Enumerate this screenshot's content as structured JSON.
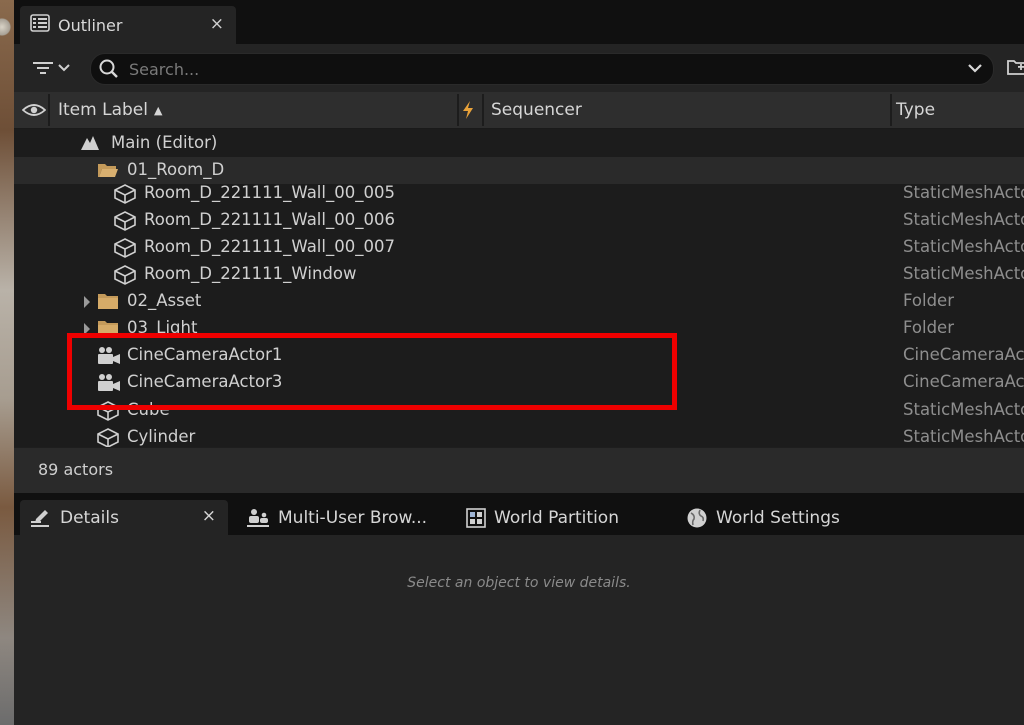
{
  "outliner": {
    "tab_title": "Outliner",
    "close_glyph": "×",
    "search_placeholder": "Search...",
    "columns": {
      "item_label": "Item Label",
      "sort_glyph": "▲",
      "sequencer": "Sequencer",
      "type": "Type"
    },
    "rows": [
      {
        "label": "Main (Editor)",
        "type": "",
        "icon": "level-icon"
      },
      {
        "label": "01_Room_D",
        "type": "",
        "icon": "folder-open-icon"
      },
      {
        "label": "Room_D_221111_Wall_00_005",
        "type": "StaticMeshActo",
        "icon": "static-mesh-icon"
      },
      {
        "label": "Room_D_221111_Wall_00_006",
        "type": "StaticMeshActo",
        "icon": "static-mesh-icon"
      },
      {
        "label": "Room_D_221111_Wall_00_007",
        "type": "StaticMeshActo",
        "icon": "static-mesh-icon"
      },
      {
        "label": "Room_D_221111_Window",
        "type": "StaticMeshActo",
        "icon": "static-mesh-icon"
      },
      {
        "label": "02_Asset",
        "type": "Folder",
        "icon": "folder-icon"
      },
      {
        "label": "03_Light",
        "type": "Folder",
        "icon": "folder-icon"
      },
      {
        "label": "CineCameraActor1",
        "type": "CineCameraAct",
        "icon": "camera-icon"
      },
      {
        "label": "CineCameraActor3",
        "type": "CineCameraAct",
        "icon": "camera-icon"
      },
      {
        "label": "Cube",
        "type": "StaticMeshActo",
        "icon": "static-mesh-icon"
      },
      {
        "label": "Cylinder",
        "type": "StaticMeshActo",
        "icon": "static-mesh-icon"
      }
    ],
    "status": "89 actors"
  },
  "bottom_tabs": [
    {
      "label": "Details",
      "icon": "pencil-icon"
    },
    {
      "label": "Multi-User Brow...",
      "icon": "users-icon"
    },
    {
      "label": "World Partition",
      "icon": "grid-icon"
    },
    {
      "label": "World Settings",
      "icon": "globe-icon"
    }
  ],
  "details": {
    "empty_message": "Select an object to view details."
  },
  "colors": {
    "highlight": "#ee0000",
    "folder": "#c49a5a"
  }
}
